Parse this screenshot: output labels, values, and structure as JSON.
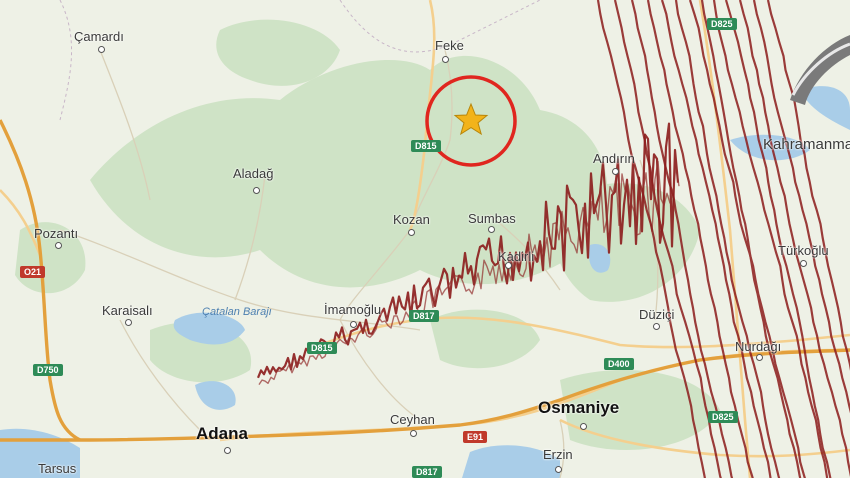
{
  "map": {
    "colors": {
      "background": "#eef1e6",
      "forest": "#cfe3c6",
      "water": "#a9cde8",
      "motorway": "#e3a03c",
      "road": "#f4cf8e",
      "minor_road": "#d9d0b8",
      "seismo": "#8c1c1c",
      "ring": "#e0261f",
      "star": "#f2b31a"
    },
    "places": [
      {
        "name": "Çamardı",
        "big": false
      },
      {
        "name": "Feke",
        "big": false
      },
      {
        "name": "Aladağ",
        "big": false
      },
      {
        "name": "Pozantı",
        "big": false
      },
      {
        "name": "Kozan",
        "big": false
      },
      {
        "name": "Sumbas",
        "big": false
      },
      {
        "name": "Andırın",
        "big": false
      },
      {
        "name": "Kahramanmaraş",
        "big": false
      },
      {
        "name": "Türkoğlu",
        "big": false
      },
      {
        "name": "Kadirli",
        "big": false
      },
      {
        "name": "Karaisalı",
        "big": false
      },
      {
        "name": "İmamoğlu",
        "big": false
      },
      {
        "name": "Düziçi",
        "big": false
      },
      {
        "name": "Nurdağı",
        "big": false
      },
      {
        "name": "Osmaniye",
        "big": true
      },
      {
        "name": "Adana",
        "big": true
      },
      {
        "name": "Ceyhan",
        "big": false
      },
      {
        "name": "Erzin",
        "big": false
      },
      {
        "name": "Tarsus",
        "big": false
      }
    ],
    "lakes": [
      {
        "name": "Çatalan Barajı"
      }
    ],
    "shields": [
      {
        "label": "D825",
        "color": "g"
      },
      {
        "label": "D815",
        "color": "g"
      },
      {
        "label": "O21",
        "color": "r"
      },
      {
        "label": "D817",
        "color": "g"
      },
      {
        "label": "D815",
        "color": "g"
      },
      {
        "label": "D750",
        "color": "g"
      },
      {
        "label": "D400",
        "color": "g"
      },
      {
        "label": "E91",
        "color": "r"
      },
      {
        "label": "D825",
        "color": "g"
      },
      {
        "label": "D817",
        "color": "g"
      }
    ],
    "epicenter": {
      "marker": "star-icon"
    }
  }
}
